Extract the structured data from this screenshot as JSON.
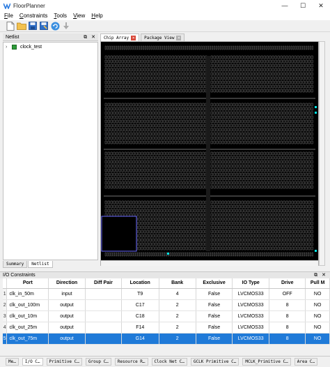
{
  "app": {
    "title": "FloorPlanner"
  },
  "window_controls": {
    "minimize": "—",
    "maximize": "☐",
    "close": "✕"
  },
  "menu": [
    {
      "label": "File",
      "accel": "F",
      "rest": "ile"
    },
    {
      "label": "Constraints",
      "accel": "C",
      "rest": "onstraints"
    },
    {
      "label": "Tools",
      "accel": "T",
      "rest": "ools"
    },
    {
      "label": "View",
      "accel": "V",
      "rest": "iew"
    },
    {
      "label": "Help",
      "accel": "H",
      "rest": "elp"
    }
  ],
  "toolbar": [
    "new-file-icon",
    "open-folder-icon",
    "save-icon",
    "save-as-icon",
    "refresh-icon",
    "download-icon"
  ],
  "netlist": {
    "title": "Netlist",
    "tree_item": "clock_test",
    "tabs": [
      "Summary",
      "Netlist"
    ],
    "active_tab": "Netlist"
  },
  "editor": {
    "tabs": [
      {
        "label": "Chip Array",
        "active": true
      },
      {
        "label": "Package View",
        "active": false
      }
    ]
  },
  "colors": {
    "selection": "#1f7ad8",
    "chip_bg": "#000000",
    "cell": "#8a8a8a",
    "highlight": "#6a6aff",
    "pin_cyan": "#00e5e5"
  },
  "io": {
    "title": "I/O Constraints",
    "columns": [
      "Port",
      "Direction",
      "Diff Pair",
      "Location",
      "Bank",
      "Exclusive",
      "IO Type",
      "Drive",
      "Pull M"
    ],
    "rows": [
      {
        "num": "1",
        "port": "clk_in_50m",
        "direction": "input",
        "diff_pair": "",
        "location": "T9",
        "bank": "4",
        "exclusive": "False",
        "io_type": "LVCMOS33",
        "drive": "OFF",
        "pull": "NO"
      },
      {
        "num": "2",
        "port": "clk_out_100m",
        "direction": "output",
        "diff_pair": "",
        "location": "C17",
        "bank": "2",
        "exclusive": "False",
        "io_type": "LVCMOS33",
        "drive": "8",
        "pull": "NO"
      },
      {
        "num": "3",
        "port": "clk_out_10m",
        "direction": "output",
        "diff_pair": "",
        "location": "C18",
        "bank": "2",
        "exclusive": "False",
        "io_type": "LVCMOS33",
        "drive": "8",
        "pull": "NO"
      },
      {
        "num": "4",
        "port": "clk_out_25m",
        "direction": "output",
        "diff_pair": "",
        "location": "F14",
        "bank": "2",
        "exclusive": "False",
        "io_type": "LVCMOS33",
        "drive": "8",
        "pull": "NO"
      },
      {
        "num": "5",
        "port": "clk_out_75m",
        "direction": "output",
        "diff_pair": "",
        "location": "G14",
        "bank": "2",
        "exclusive": "False",
        "io_type": "LVCMOS33",
        "drive": "8",
        "pull": "NO"
      }
    ],
    "selected_row": 4
  },
  "status_tabs": [
    "Me…",
    "I/O C…",
    "Primitive C…",
    "Group C…",
    "Resource R…",
    "Clock Net C…",
    "GCLK Primitive C…",
    "MCLK_Primitive C…",
    "Area C…"
  ],
  "active_status_tab": "I/O C…"
}
